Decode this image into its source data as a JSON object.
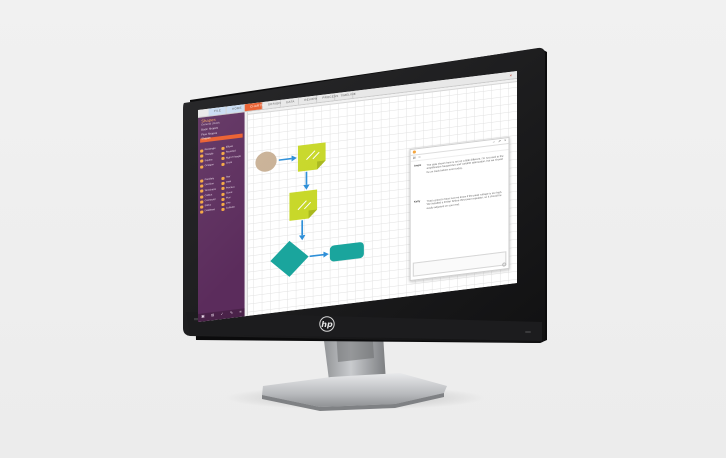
{
  "menu": {
    "tabs": [
      {
        "label": "FILE",
        "style": "blue"
      },
      {
        "label": "HOME",
        "style": "blue"
      },
      {
        "label": "CHARTS",
        "style": "active"
      },
      {
        "label": "DESIGN",
        "style": "normal"
      },
      {
        "label": "DATA",
        "style": "normal"
      },
      {
        "label": "REVIEW",
        "style": "normal"
      },
      {
        "label": "PROCESS",
        "style": "normal"
      },
      {
        "label": "TIMELINE",
        "style": "normal"
      }
    ]
  },
  "sidebar": {
    "title": "Shapes",
    "subtitle": "General | Basic",
    "items": [
      {
        "label": "Basic Shapes",
        "selected": false
      },
      {
        "label": "Flow Shapes",
        "selected": false
      },
      {
        "label": "Shapes",
        "selected": true
      }
    ],
    "shapes_top": [
      "Rectangle",
      "Ellipse",
      "Triangle",
      "Rounded",
      "Square",
      "Right Triangle",
      "Octagon",
      "Circle"
    ],
    "shapes_bottom": [
      "Parallelo",
      "Star",
      "Decision",
      "Data",
      "Terminator",
      "Process",
      "Callout",
      "Cloud",
      "Connector",
      "Plus",
      "Sticky",
      "Line",
      "Database",
      "Cylinder"
    ],
    "footer_icons": [
      "save-icon",
      "delete-icon",
      "check-icon",
      "pencil-icon",
      "layers-icon"
    ]
  },
  "chat": {
    "messages": [
      {
        "author": "Angie",
        "text": "The data shown here is set up a little different. I'm not used to the amplification frequencies and variable attenuation, but we should be on track before noon today."
      },
      {
        "author": "Kelly",
        "text": "That's great to hear! Let me know if the peak voltage is too high. We installed a limiter before the power regulator, so it should be easily adjusted on your end."
      }
    ]
  },
  "brand": {
    "logo": "hp"
  },
  "colors": {
    "sidebar": "#5b2c5c",
    "accent": "#ea5b2a",
    "lime": "#c8d82a",
    "teal": "#1aa59d",
    "arrow": "#2e8fd8",
    "circle": "#c9b196"
  }
}
